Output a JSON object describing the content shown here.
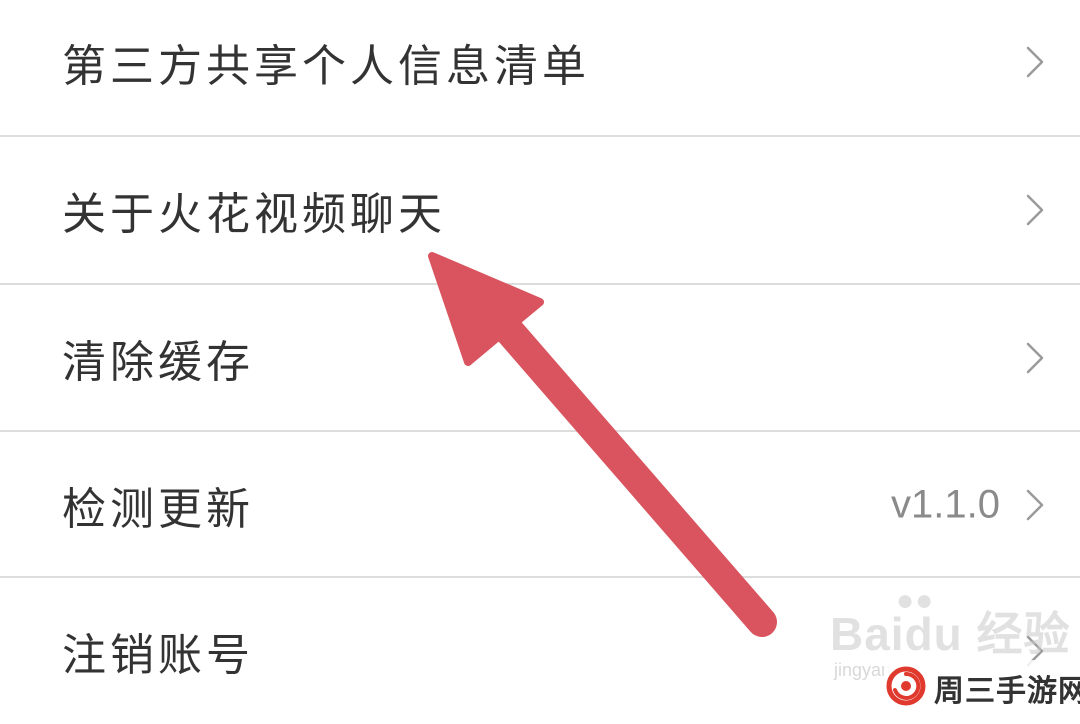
{
  "settings": {
    "items": [
      {
        "label": "第三方共享个人信息清单",
        "value": ""
      },
      {
        "label": "关于火花视频聊天",
        "value": ""
      },
      {
        "label": "清除缓存",
        "value": ""
      },
      {
        "label": "检测更新",
        "value": "v1.1.0"
      },
      {
        "label": "注销账号",
        "value": ""
      }
    ],
    "chevron_icon": "chevron-right-icon"
  },
  "annotation": {
    "arrow_color": "#d9545e",
    "arrow_icon": "arrow-annotation"
  },
  "watermarks": {
    "baidu": "Baidu 经验",
    "baidu_sub": "jingyan",
    "site": "周三手游网",
    "site_logo": "spiral-logo-icon"
  },
  "colors": {
    "text": "#333333",
    "value": "#8a8a8a",
    "divider": "#dddddd",
    "background": "#ffffff"
  }
}
